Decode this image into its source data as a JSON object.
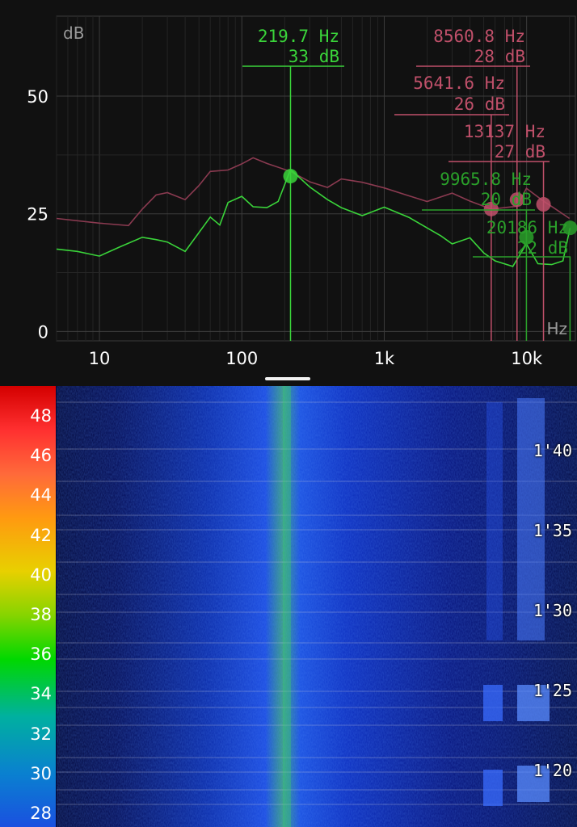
{
  "chart_data": [
    {
      "type": "line",
      "xscale": "log",
      "xlabel": "Hz",
      "ylabel": "dB",
      "xlim": [
        5,
        22000
      ],
      "ylim": [
        -2,
        67
      ],
      "x_ticks": [
        {
          "value": 10,
          "label": "10"
        },
        {
          "value": 100,
          "label": "100"
        },
        {
          "value": 1000,
          "label": "1k"
        },
        {
          "value": 10000,
          "label": "10k"
        }
      ],
      "y_ticks": [
        {
          "value": 0,
          "label": "0"
        },
        {
          "value": 25,
          "label": "25"
        },
        {
          "value": 50,
          "label": "50"
        }
      ],
      "grid": true,
      "series": [
        {
          "color": "#8a3a50",
          "x": [
            5,
            10,
            16,
            20,
            25,
            30,
            40,
            50,
            60,
            80,
            100,
            120,
            150,
            219.7,
            300,
            400,
            500,
            700,
            1000,
            1500,
            2000,
            3000,
            4000,
            5641.6,
            7000,
            8560.8,
            9965.8,
            13137,
            16000,
            20000
          ],
          "y": [
            24,
            23,
            22.5,
            26,
            29,
            29.5,
            28,
            31,
            34,
            35,
            37,
            35.5,
            35,
            34,
            32.5,
            32,
            31,
            31,
            30.5,
            29.5,
            29,
            28,
            27,
            26,
            27,
            28,
            29,
            27,
            26,
            24
          ]
        },
        {
          "color": "#3ad43a",
          "x": [
            5,
            7,
            10,
            14,
            20,
            25,
            30,
            40,
            50,
            60,
            70,
            80,
            100,
            120,
            150,
            180,
            219.7,
            300,
            400,
            500,
            700,
            1000,
            1500,
            2000,
            2500,
            3000,
            4000,
            5000,
            6000,
            8000,
            9965.8,
            12000,
            15000,
            18000,
            20186
          ],
          "y": [
            17.5,
            17,
            16,
            18,
            20,
            19.5,
            19,
            17,
            21,
            25,
            24,
            26,
            28,
            26.5,
            27,
            29,
            33,
            30,
            28,
            27,
            26,
            25,
            23.5,
            22,
            21,
            20,
            18.5,
            16,
            15,
            14.5,
            20,
            13,
            13.5,
            15,
            22
          ]
        }
      ],
      "markers": [
        {
          "freq": "219.7 Hz",
          "level": "33 dB",
          "x": 219.7,
          "y": 33,
          "color": "#3ad43a"
        },
        {
          "freq": "8560.8 Hz",
          "level": "28 dB",
          "x": 8560.8,
          "y": 28,
          "color": "#c0506a"
        },
        {
          "freq": "5641.6 Hz",
          "level": "26 dB",
          "x": 5641.6,
          "y": 26,
          "color": "#c0506a"
        },
        {
          "freq": "13137 Hz",
          "level": "27 dB",
          "x": 13137,
          "y": 27,
          "color": "#c0506a"
        },
        {
          "freq": "9965.8 Hz",
          "level": "20 dB",
          "x": 9965.8,
          "y": 20,
          "color": "#2aa02a"
        },
        {
          "freq": "20186 Hz",
          "level": "22 dB",
          "x": 20186,
          "y": 22,
          "color": "#2aa02a"
        }
      ]
    },
    {
      "type": "heatmap",
      "colorbar_labels": [
        "48",
        "46",
        "44",
        "42",
        "40",
        "38",
        "36",
        "34",
        "32",
        "30",
        "28"
      ],
      "time_labels": [
        "1'40",
        "1'35",
        "1'30",
        "1'25",
        "1'20"
      ]
    }
  ]
}
